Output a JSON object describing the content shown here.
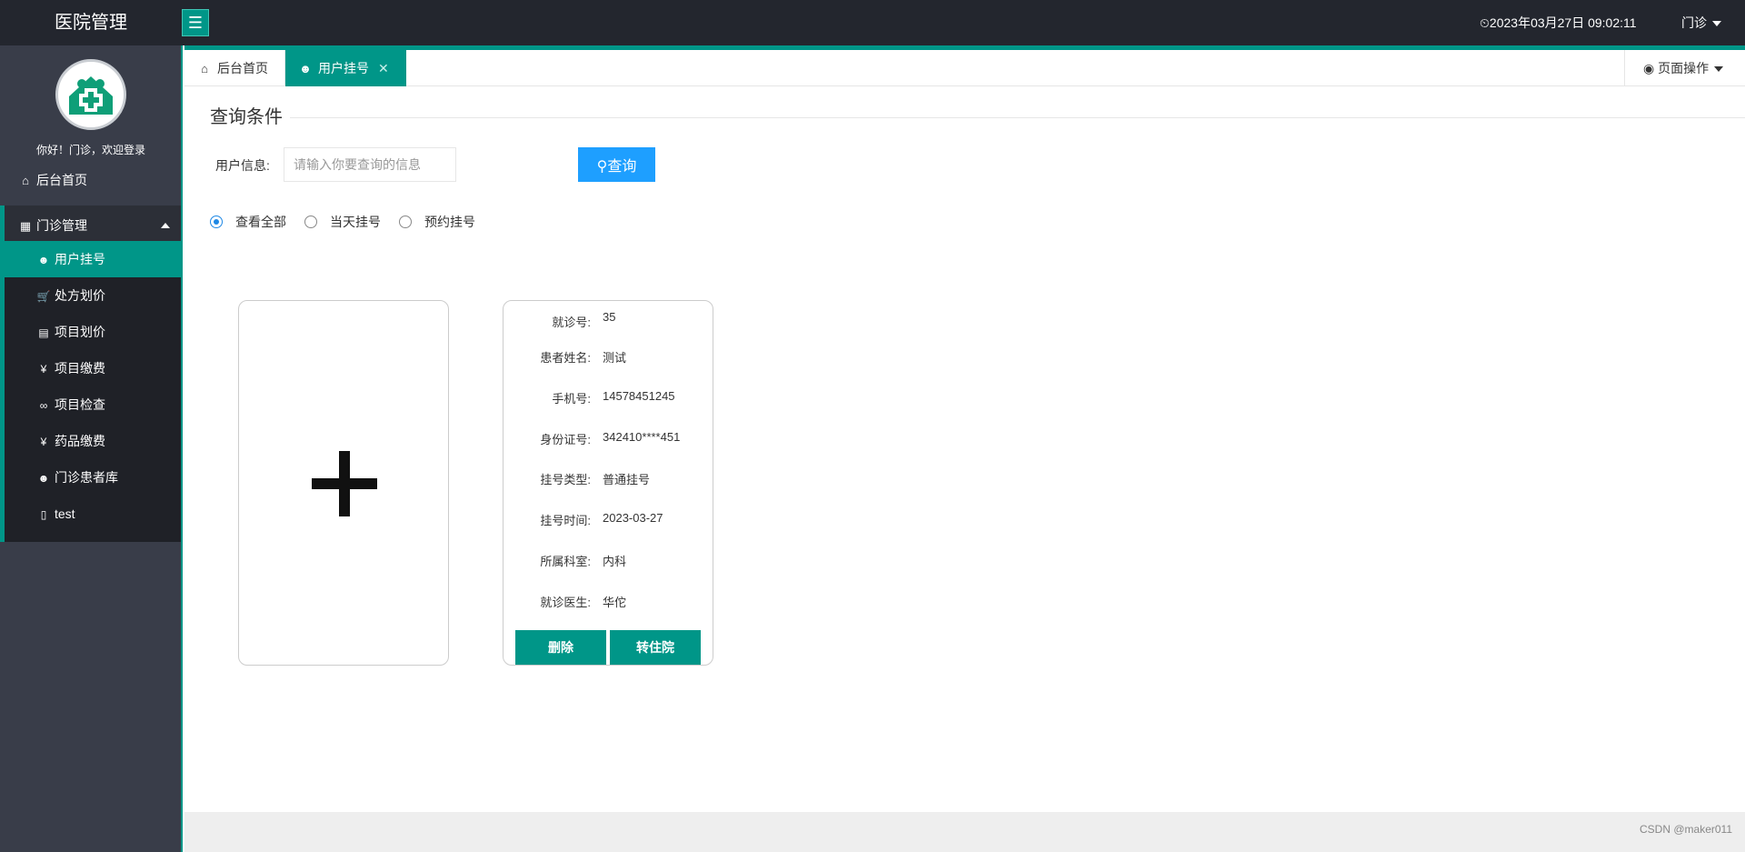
{
  "header": {
    "logo": "医院管理",
    "datetime": "⏲2023年03月27日 09:02:11",
    "user": "门诊"
  },
  "sidebar": {
    "welcome": "你好！门诊，欢迎登录",
    "home": "后台首页",
    "group": "门诊管理",
    "items": [
      {
        "label": "用户挂号",
        "icon": "user-icon"
      },
      {
        "label": "处方划价",
        "icon": "cart-icon"
      },
      {
        "label": "项目划价",
        "icon": "document-icon"
      },
      {
        "label": "项目缴费",
        "icon": "yen-icon"
      },
      {
        "label": "项目检查",
        "icon": "link-icon"
      },
      {
        "label": "药品缴费",
        "icon": "yen-icon"
      },
      {
        "label": "门诊患者库",
        "icon": "user-icon"
      },
      {
        "label": "test",
        "icon": "mobile-icon"
      }
    ]
  },
  "tabs": {
    "home": "后台首页",
    "active": "用户挂号",
    "page_ops": "页面操作"
  },
  "query": {
    "legend": "查询条件",
    "label": "用户信息:",
    "placeholder": "请输入你要查询的信息",
    "button": "查询"
  },
  "filters": {
    "all": "查看全部",
    "today": "当天挂号",
    "appointment": "预约挂号",
    "selected": "all"
  },
  "card": {
    "rows": [
      {
        "k": "就诊号:",
        "v": "35"
      },
      {
        "k": "患者姓名:",
        "v": "测试"
      },
      {
        "k": "手机号:",
        "v": "14578451245"
      },
      {
        "k": "身份证号:",
        "v": "342410****451"
      },
      {
        "k": "挂号类型:",
        "v": "普通挂号"
      },
      {
        "k": "挂号时间:",
        "v": "2023-03-27"
      },
      {
        "k": "所属科室:",
        "v": "内科"
      },
      {
        "k": "就诊医生:",
        "v": "华佗"
      }
    ],
    "delete": "删除",
    "transfer": "转住院"
  },
  "footer": {
    "watermark": "CSDN @maker011"
  },
  "colors": {
    "primary": "#009688",
    "header": "#23262e",
    "sidebar": "#393d49",
    "query_button": "#1e9fff"
  }
}
